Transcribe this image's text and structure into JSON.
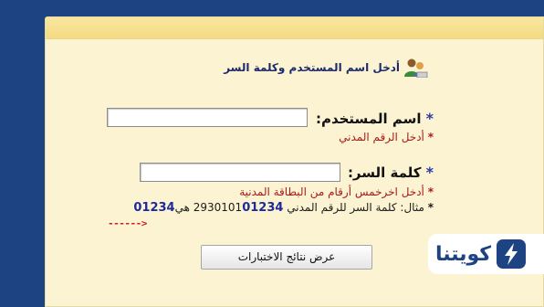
{
  "form": {
    "heading": "أدخل اسم المستخدم وكلمة السر",
    "username_label": "اسم المستخدم:",
    "username_value": "",
    "username_hint": "أدخل الرقم المدني",
    "password_label": "كلمة السر:",
    "password_value": "",
    "password_hint": "أدخل اخرخمس أرقام من البطاقة المدنية",
    "star": "*",
    "example_prefix": "مثال: كلمة السر للرقم المدني 2930101",
    "example_bold1": "01234",
    "example_mid": " هي",
    "example_bold2": "01234",
    "arrow": "------>",
    "submit_label": "عرض نتائج الاختبارات"
  },
  "logo": {
    "text": "كويتنا"
  },
  "colors": {
    "background": "#1e4382",
    "panel": "#fbf3d2",
    "panel_header": "#f4db82",
    "hint_red": "#a81c1c",
    "accent_blue": "#1c2a9a"
  },
  "icons": {
    "heading_icon": "users-icon",
    "logo_icon": "lightning-bolt-icon"
  }
}
